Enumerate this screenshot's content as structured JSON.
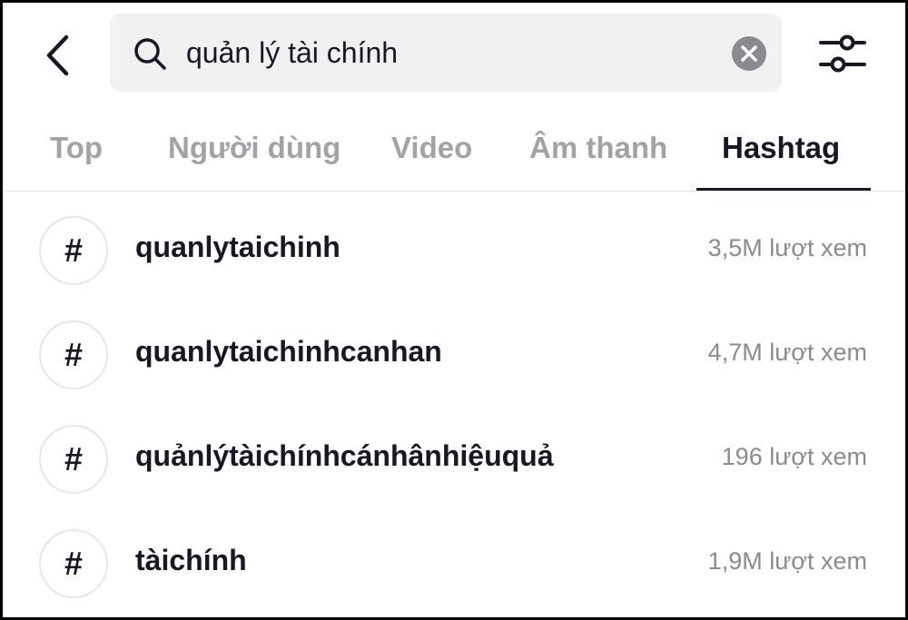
{
  "header": {
    "back_icon": "chevron-left-icon",
    "search": {
      "value": "quản lý tài chính",
      "search_icon": "search-icon",
      "clear_icon": "clear-circle-icon"
    },
    "filter_icon": "sliders-icon"
  },
  "tabs": [
    {
      "label": "Top",
      "active": false
    },
    {
      "label": "Người dùng",
      "active": false
    },
    {
      "label": "Video",
      "active": false
    },
    {
      "label": "Âm thanh",
      "active": false
    },
    {
      "label": "Hashtag",
      "active": true
    }
  ],
  "hashtags": [
    {
      "icon": "#",
      "name": "quanlytaichinh",
      "views": "3,5M lượt xem"
    },
    {
      "icon": "#",
      "name": "quanlytaichinhcanhan",
      "views": "4,7M lượt xem"
    },
    {
      "icon": "#",
      "name": "quảnlýtàichínhcánhânhiệuquả",
      "views": "196 lượt xem"
    },
    {
      "icon": "#",
      "name": "tàichính",
      "views": "1,9M lượt xem"
    }
  ],
  "colors": {
    "text_primary": "#161823",
    "text_inactive_tab": "#a2a3a7",
    "text_secondary": "#8a8b91",
    "search_bg": "#f1f1f2"
  }
}
